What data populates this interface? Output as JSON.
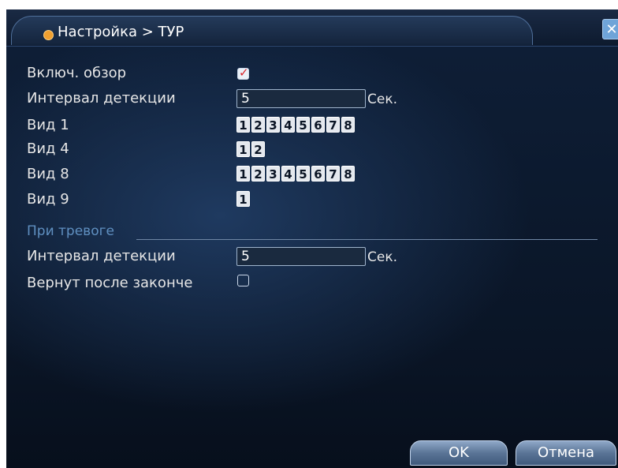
{
  "window": {
    "title": "Настройка > ТУР",
    "close_label": "✕"
  },
  "form": {
    "enable_tour": {
      "label": "Включ. обзор",
      "checked": true
    },
    "interval": {
      "label": "Интервал детекции",
      "value": "5",
      "unit": "Сек."
    },
    "views": [
      {
        "label": "Вид 1",
        "channels": [
          "1",
          "2",
          "3",
          "4",
          "5",
          "6",
          "7",
          "8"
        ]
      },
      {
        "label": "Вид 4",
        "channels": [
          "1",
          "2"
        ]
      },
      {
        "label": "Вид 8",
        "channels": [
          "1",
          "2",
          "3",
          "4",
          "5",
          "6",
          "7",
          "8"
        ]
      },
      {
        "label": "Вид 9",
        "channels": [
          "1"
        ]
      }
    ],
    "alarm_section": {
      "title": "При тревоге",
      "interval": {
        "label": "Интервал детекции",
        "value": "5",
        "unit": "Сек."
      },
      "return_after": {
        "label": "Вернут после законче",
        "checked": false
      }
    }
  },
  "buttons": {
    "ok": "OK",
    "cancel": "Отмена"
  }
}
